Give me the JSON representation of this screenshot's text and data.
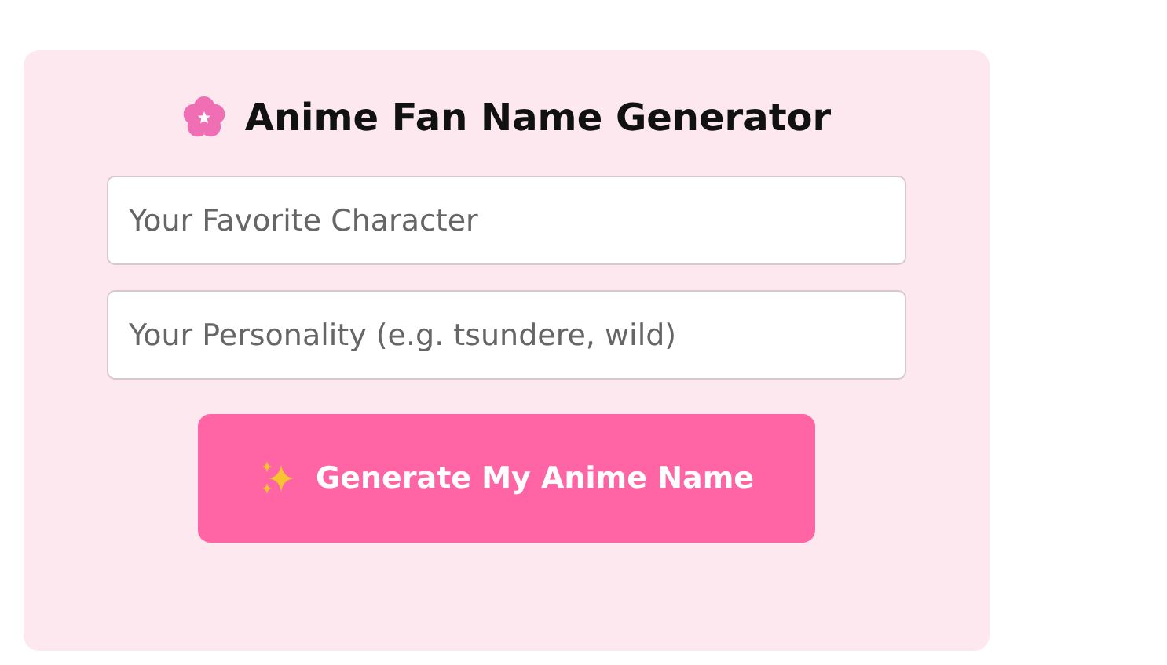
{
  "title": "Anime Fan Name Generator",
  "fields": [
    {
      "placeholder": "Your Favorite Character"
    },
    {
      "placeholder": "Your Personality (e.g. tsundere, wild)"
    }
  ],
  "button": {
    "label": "Generate My Anime Name"
  }
}
